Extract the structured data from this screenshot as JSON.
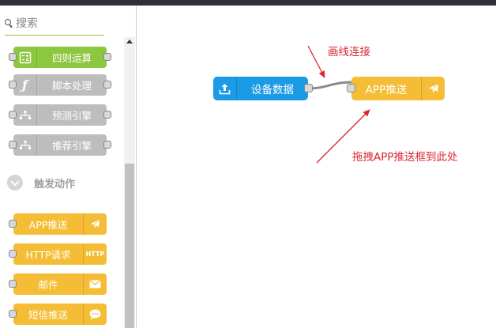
{
  "search": {
    "placeholder": "搜索"
  },
  "palette": {
    "function_nodes": [
      {
        "label": "四则运算",
        "icon": "calculator-icon",
        "color": "#8dc63f"
      },
      {
        "label": "脚本处理",
        "icon": "function-icon",
        "color": "#bdbdbd"
      },
      {
        "label": "预测引擎",
        "icon": "hierarchy-icon",
        "color": "#bdbdbd"
      },
      {
        "label": "推荐引擎",
        "icon": "hierarchy-icon",
        "color": "#bdbdbd"
      }
    ],
    "section_title": "触发动作",
    "action_nodes": [
      {
        "label": "APP推送",
        "icon": "paper-plane-icon",
        "color": "#f5bd35"
      },
      {
        "label": "HTTP请求",
        "icon": "http-icon",
        "icon_text": "HTTP",
        "color": "#f5bd35"
      },
      {
        "label": "邮件",
        "icon": "envelope-icon",
        "color": "#f5bd35"
      },
      {
        "label": "短信推送",
        "icon": "chat-bubble-icon",
        "color": "#f5bd35"
      }
    ]
  },
  "canvas": {
    "source_node": {
      "label": "设备数据",
      "icon": "upload-icon",
      "color": "#1b9be6"
    },
    "target_node": {
      "label": "APP推送",
      "icon": "paper-plane-icon",
      "color": "#f5bd35"
    },
    "annotations": {
      "draw_line": "画线连接",
      "drag_here": "拖拽APP推送框到此处"
    }
  },
  "colors": {
    "annotation": "#d9272e",
    "topbar": "#2e3238"
  }
}
